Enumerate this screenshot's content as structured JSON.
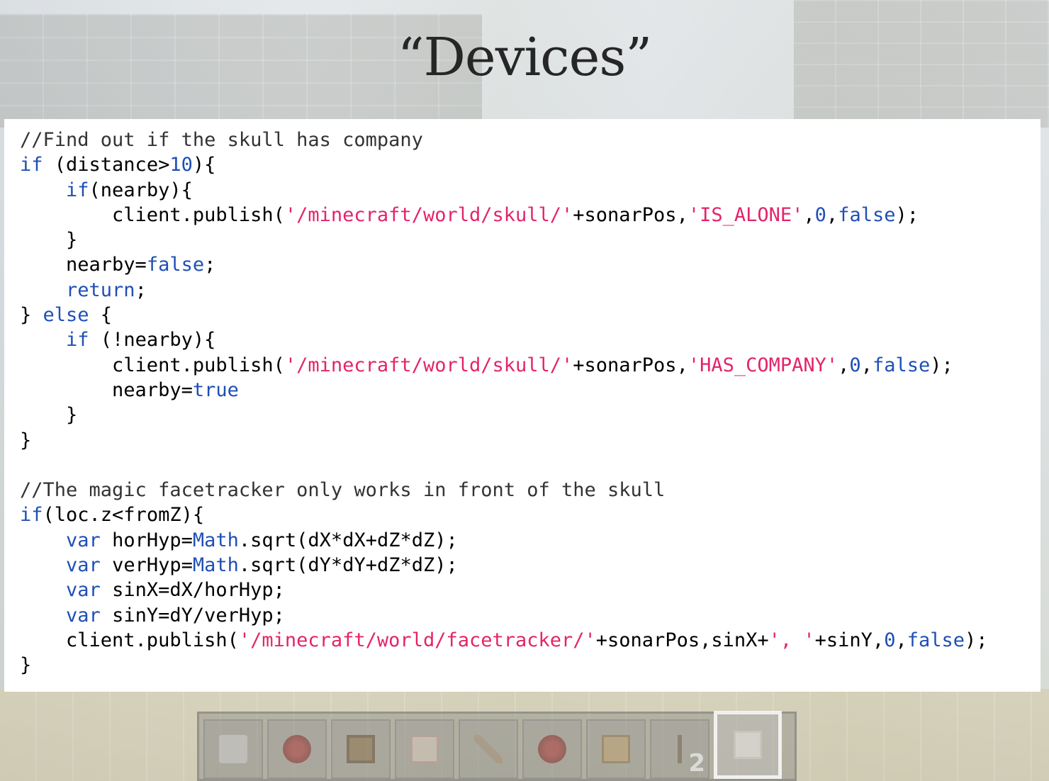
{
  "slide": {
    "title": "“Devices”"
  },
  "code": {
    "lines": [
      [
        {
          "t": "//Find out if the skull has company",
          "c": "cmt"
        }
      ],
      [
        {
          "t": "if",
          "c": "kw"
        },
        {
          "t": " (distance>"
        },
        {
          "t": "10",
          "c": "num"
        },
        {
          "t": "){"
        }
      ],
      [
        {
          "t": "    "
        },
        {
          "t": "if",
          "c": "kw"
        },
        {
          "t": "(nearby){"
        }
      ],
      [
        {
          "t": "        client.publish("
        },
        {
          "t": "'/minecraft/world/skull/'",
          "c": "str"
        },
        {
          "t": "+sonarPos,"
        },
        {
          "t": "'IS_ALONE'",
          "c": "str"
        },
        {
          "t": ","
        },
        {
          "t": "0",
          "c": "num"
        },
        {
          "t": ","
        },
        {
          "t": "false",
          "c": "kw"
        },
        {
          "t": ");"
        }
      ],
      [
        {
          "t": "    }"
        }
      ],
      [
        {
          "t": "    nearby="
        },
        {
          "t": "false",
          "c": "kw"
        },
        {
          "t": ";"
        }
      ],
      [
        {
          "t": "    "
        },
        {
          "t": "return",
          "c": "kw"
        },
        {
          "t": ";"
        }
      ],
      [
        {
          "t": "} "
        },
        {
          "t": "else",
          "c": "kw"
        },
        {
          "t": " {"
        }
      ],
      [
        {
          "t": "    "
        },
        {
          "t": "if",
          "c": "kw"
        },
        {
          "t": " (!nearby){"
        }
      ],
      [
        {
          "t": "        client.publish("
        },
        {
          "t": "'/minecraft/world/skull/'",
          "c": "str"
        },
        {
          "t": "+sonarPos,"
        },
        {
          "t": "'HAS_COMPANY'",
          "c": "str"
        },
        {
          "t": ","
        },
        {
          "t": "0",
          "c": "num"
        },
        {
          "t": ","
        },
        {
          "t": "false",
          "c": "kw"
        },
        {
          "t": ");"
        }
      ],
      [
        {
          "t": "        nearby="
        },
        {
          "t": "true",
          "c": "kw"
        }
      ],
      [
        {
          "t": "    }"
        }
      ],
      [
        {
          "t": "}"
        }
      ],
      [
        {
          "t": ""
        }
      ],
      [
        {
          "t": "//The magic facetracker only works in front of the skull",
          "c": "cmt"
        }
      ],
      [
        {
          "t": "if",
          "c": "kw"
        },
        {
          "t": "(loc.z<fromZ){"
        }
      ],
      [
        {
          "t": "    "
        },
        {
          "t": "var",
          "c": "kw"
        },
        {
          "t": " horHyp="
        },
        {
          "t": "Math",
          "c": "kw"
        },
        {
          "t": ".sqrt(dX*dX+dZ*dZ);"
        }
      ],
      [
        {
          "t": "    "
        },
        {
          "t": "var",
          "c": "kw"
        },
        {
          "t": " verHyp="
        },
        {
          "t": "Math",
          "c": "kw"
        },
        {
          "t": ".sqrt(dY*dY+dZ*dZ);"
        }
      ],
      [
        {
          "t": "    "
        },
        {
          "t": "var",
          "c": "kw"
        },
        {
          "t": " sinX=dX/horHyp;"
        }
      ],
      [
        {
          "t": "    "
        },
        {
          "t": "var",
          "c": "kw"
        },
        {
          "t": " sinY=dY/verHyp;"
        }
      ],
      [
        {
          "t": "    client.publish("
        },
        {
          "t": "'/minecraft/world/facetracker/'",
          "c": "str"
        },
        {
          "t": "+sonarPos,sinX+"
        },
        {
          "t": "', '",
          "c": "str"
        },
        {
          "t": "+sinY,"
        },
        {
          "t": "0",
          "c": "num"
        },
        {
          "t": ","
        },
        {
          "t": "false",
          "c": "kw"
        },
        {
          "t": ");"
        }
      ],
      [
        {
          "t": "}"
        }
      ]
    ]
  },
  "hotbar": {
    "slots": [
      {
        "icon": "skull-icon"
      },
      {
        "icon": "redstone-icon"
      },
      {
        "icon": "command-block-icon"
      },
      {
        "icon": "block-icon"
      },
      {
        "icon": "lever-icon"
      },
      {
        "icon": "redstone-icon"
      },
      {
        "icon": "sign-icon"
      },
      {
        "icon": "torch-icon",
        "count": "2"
      },
      {
        "icon": "quartz-block-icon",
        "selected": true
      }
    ]
  }
}
